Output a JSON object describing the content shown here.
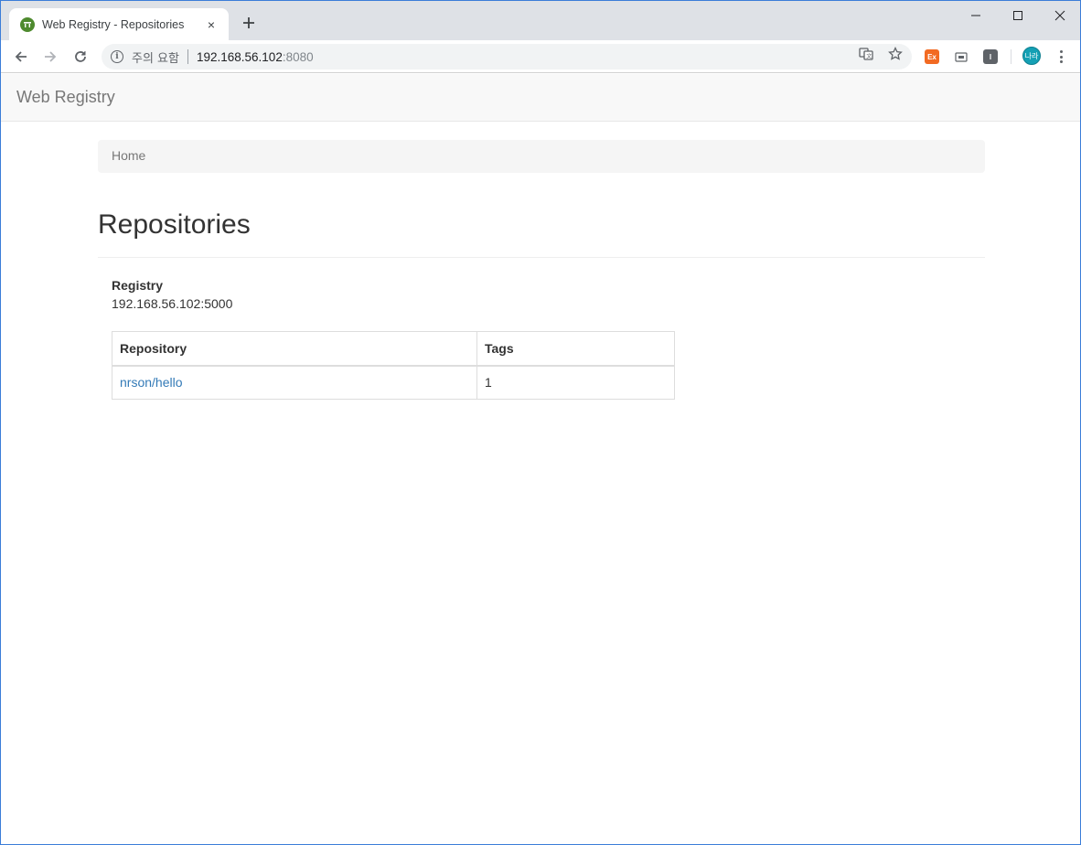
{
  "browser": {
    "tab_title": "Web Registry - Repositories",
    "tab_close": "×",
    "new_tab": "+",
    "address": {
      "security_warning": "주의 요함",
      "host": "192.168.56.102",
      "port": ":8080"
    },
    "profile_avatar": "나라",
    "extensions": {
      "ext1": "Ex",
      "ext2": "I"
    }
  },
  "navbar": {
    "brand": "Web Registry"
  },
  "breadcrumb": {
    "items": [
      "Home"
    ]
  },
  "page": {
    "title": "Repositories"
  },
  "registry": {
    "label": "Registry",
    "value": "192.168.56.102:5000"
  },
  "table": {
    "headers": [
      "Repository",
      "Tags"
    ],
    "rows": [
      {
        "repository": "nrson/hello",
        "tags": "1"
      }
    ]
  },
  "icons": {
    "back": "back-arrow-icon",
    "forward": "forward-arrow-icon",
    "reload": "reload-icon",
    "info": "info-icon",
    "translate": "translate-icon",
    "bookmark": "star-icon",
    "cast": "cast-icon",
    "menu": "kebab-menu-icon"
  },
  "colors": {
    "link": "#337ab7",
    "navbar_bg": "#f8f8f8",
    "tabstrip_bg": "#dee1e6",
    "avatar_bg": "#14a0b4",
    "ext_orange": "#f26a22"
  }
}
